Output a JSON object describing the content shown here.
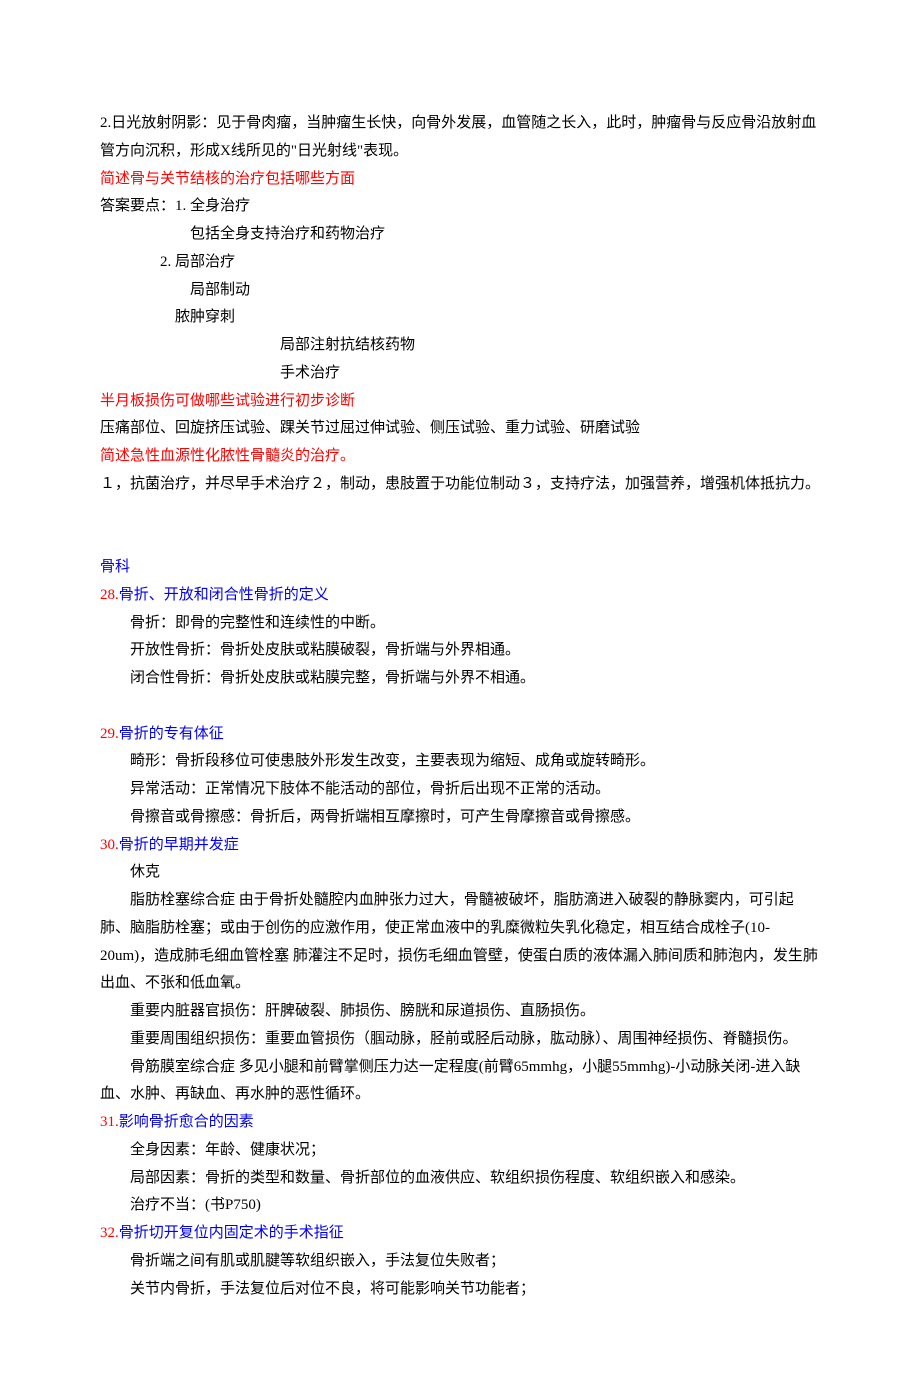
{
  "top": {
    "p1": "2.日光放射阴影：见于骨肉瘤，当肿瘤生长快，向骨外发展，血管随之长入，此时，肿瘤骨与反应骨沿放射血管方向沉积，形成X线所见的\"日光射线\"表现。",
    "q1": "简述骨与关节结核的治疗包括哪些方面",
    "a1_intro": "答案要点：1. 全身治疗",
    "a1_l1": "包括全身支持治疗和药物治疗",
    "a1_2": "2. 局部治疗",
    "a1_2_l1": "局部制动",
    "a1_2_l2": "脓肿穿刺",
    "a1_2_l3": "局部注射抗结核药物",
    "a1_2_l4": "手术治疗",
    "q2": "半月板损伤可做哪些试验进行初步诊断",
    "a2": "压痛部位、回旋挤压试验、踝关节过屈过伸试验、侧压试验、重力试验、研磨试验",
    "q3": "简述急性血源性化脓性骨髓炎的治疗。",
    "a3": "１，抗菌治疗，并尽早手术治疗２，制动，患肢置于功能位制动３，支持疗法，加强营养，增强机体抵抗力。"
  },
  "section_header": "骨科",
  "items": [
    {
      "num": "28.",
      "title": "骨折、开放和闭合性骨折的定义",
      "lines": [
        "骨折：即骨的完整性和连续性的中断。",
        "开放性骨折：骨折处皮肤或粘膜破裂，骨折端与外界相通。",
        "闭合性骨折：骨折处皮肤或粘膜完整，骨折端与外界不相通。"
      ],
      "spacer_after": true
    },
    {
      "num": "29.",
      "title": "骨折的专有体征",
      "lines": [
        "畸形：骨折段移位可使患肢外形发生改变，主要表现为缩短、成角或旋转畸形。",
        "异常活动：正常情况下肢体不能活动的部位，骨折后出现不正常的活动。",
        "骨擦音或骨擦感：骨折后，两骨折端相互摩擦时，可产生骨摩擦音或骨擦感。"
      ]
    },
    {
      "num": "30.",
      "title": "骨折的早期并发症",
      "lines": [
        "休克",
        "脂肪栓塞综合症 由于骨折处髓腔内血肿张力过大，骨髓被破坏，脂肪滴进入破裂的静脉窦内，可引起肺、脑脂肪栓塞；或由于创伤的应激作用，使正常血液中的乳糜微粒失乳化稳定，相互结合成栓子(10-20um)，造成肺毛细血管栓塞 肺灌注不足时，损伤毛细血管壁，使蛋白质的液体漏入肺间质和肺泡内，发生肺出血、不张和低血氧。",
        "重要内脏器官损伤：肝脾破裂、肺损伤、膀胱和尿道损伤、直肠损伤。",
        "重要周围组织损伤：重要血管损伤（腘动脉，胫前或胫后动脉，肱动脉）、周围神经损伤、脊髓损伤。",
        "骨筋膜室综合症 多见小腿和前臂掌侧压力达一定程度(前臂65mmhg，小腿55mmhg)-小动脉关闭-进入缺血、水肿、再缺血、再水肿的恶性循环。"
      ],
      "wrap_lines": [
        1,
        4
      ]
    },
    {
      "num": "31.",
      "title": "影响骨折愈合的因素",
      "lines": [
        "全身因素：年龄、健康状况；",
        "局部因素：骨折的类型和数量、骨折部位的血液供应、软组织损伤程度、软组织嵌入和感染。",
        "治疗不当：(书P750)"
      ]
    },
    {
      "num": "32.",
      "title": "骨折切开复位内固定术的手术指征",
      "lines": [
        "骨折端之间有肌或肌腱等软组织嵌入，手法复位失败者；",
        "关节内骨折，手法复位后对位不良，将可能影响关节功能者；"
      ]
    }
  ]
}
